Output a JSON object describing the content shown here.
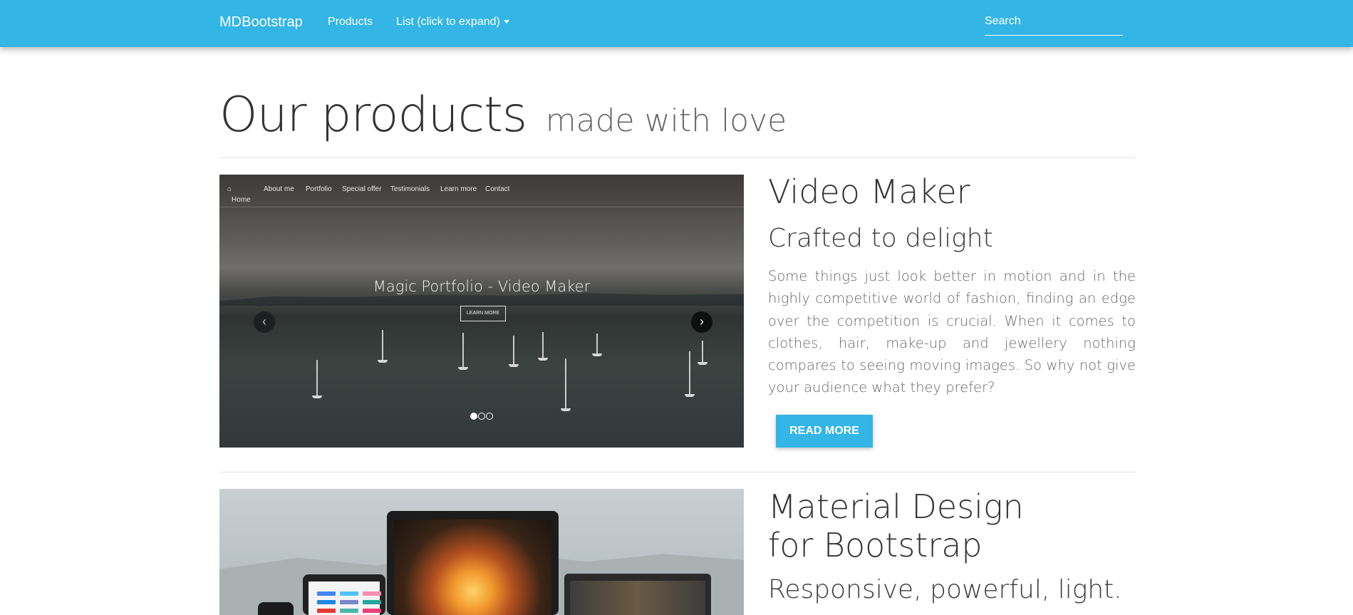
{
  "navbar": {
    "brand": "MDBootstrap",
    "products": "Products",
    "list": "List (click to expand)",
    "search_placeholder": "Search"
  },
  "header": {
    "title": "Our products",
    "subtitle": "made with love"
  },
  "products": [
    {
      "carousel": {
        "nav_items": [
          "Home",
          "About me",
          "Portfolio",
          "Special offer",
          "Testimonials",
          "Learn more",
          "Contact"
        ],
        "caption": "Magic Portfolio - Video Maker",
        "button": "LEARN MORE",
        "slides": 3,
        "active_slide": 1
      },
      "title": "Video Maker",
      "subtitle": "Crafted to delight",
      "body": "Some things just look better in motion and in the highly competitive world of fashion, finding an edge over the competition is crucial. When it comes to clothes, hair, make-up and jewellery nothing compares to seeing moving images. So why not give your audience what they prefer?",
      "button": "READ MORE"
    },
    {
      "title": "Material Design for Bootstrap",
      "subtitle": "Responsive, powerful, light."
    }
  ],
  "colors": {
    "primary": "#33b5e5",
    "text": "#333333",
    "muted": "#666666"
  }
}
